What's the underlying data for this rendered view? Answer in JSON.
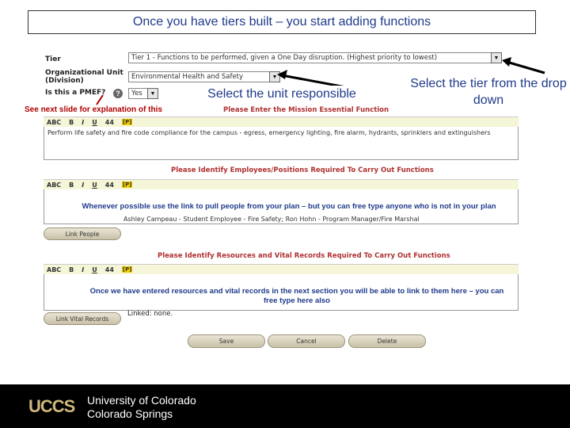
{
  "title": "Once you have tiers built – you start adding functions",
  "form": {
    "tier_label": "Tier",
    "tier_value": "Tier 1 - Functions to be performed, given a One Day disruption. (Highest priority to lowest)",
    "org_unit_label_1": "Organizational Unit",
    "org_unit_label_2": "(Division)",
    "org_unit_value": "Environmental Health and Safety",
    "pmef_label": "Is this a PMEF?",
    "pmef_value": "Yes",
    "mission_header": "Please Enter the Mission Essential Function",
    "mission_text": "Perform life safety and fire code compliance for the campus - egress, emergency lighting, fire alarm, hydrants, sprinklers and extinguishers",
    "employees_header": "Please Identify Employees/Positions Required To Carry Out Functions",
    "employees_value": "Ashley Campeau - Student Employee - Fire Safety; Ron Hohn - Program Manager/Fire Marshal",
    "link_people_button": "Link People",
    "resources_header": "Please Identify Resources and Vital Records Required To Carry Out Functions",
    "link_vital_records_button": "Link Vital Records",
    "linked_label": "Linked: none.",
    "save_button": "Save",
    "cancel_button": "Cancel",
    "delete_button": "Delete"
  },
  "toolbar": {
    "abc": "ABC",
    "bold": "B",
    "italic": "I",
    "underline": "U",
    "find": "44",
    "p": "[P]"
  },
  "annotations": {
    "unit_responsible": "Select the unit responsible",
    "tier_dropdown": "Select the tier from the drop down",
    "see_next_slide": "See next slide for explanation of this",
    "link_people_note": "Whenever possible use the link to pull people from your plan – but you can free type anyone who is not in your plan",
    "resources_note": "Once we have entered resources and vital records in the next section you will be able to link to them here – you can free type here also"
  },
  "footer": {
    "logo": "UCCS",
    "university_line1": "University of Colorado",
    "university_line2": "Colorado Springs"
  },
  "colors": {
    "title_blue": "#1f3a8a",
    "note_red": "#b00000",
    "header_red": "#b03030",
    "logo_gold": "#cfb87c"
  }
}
